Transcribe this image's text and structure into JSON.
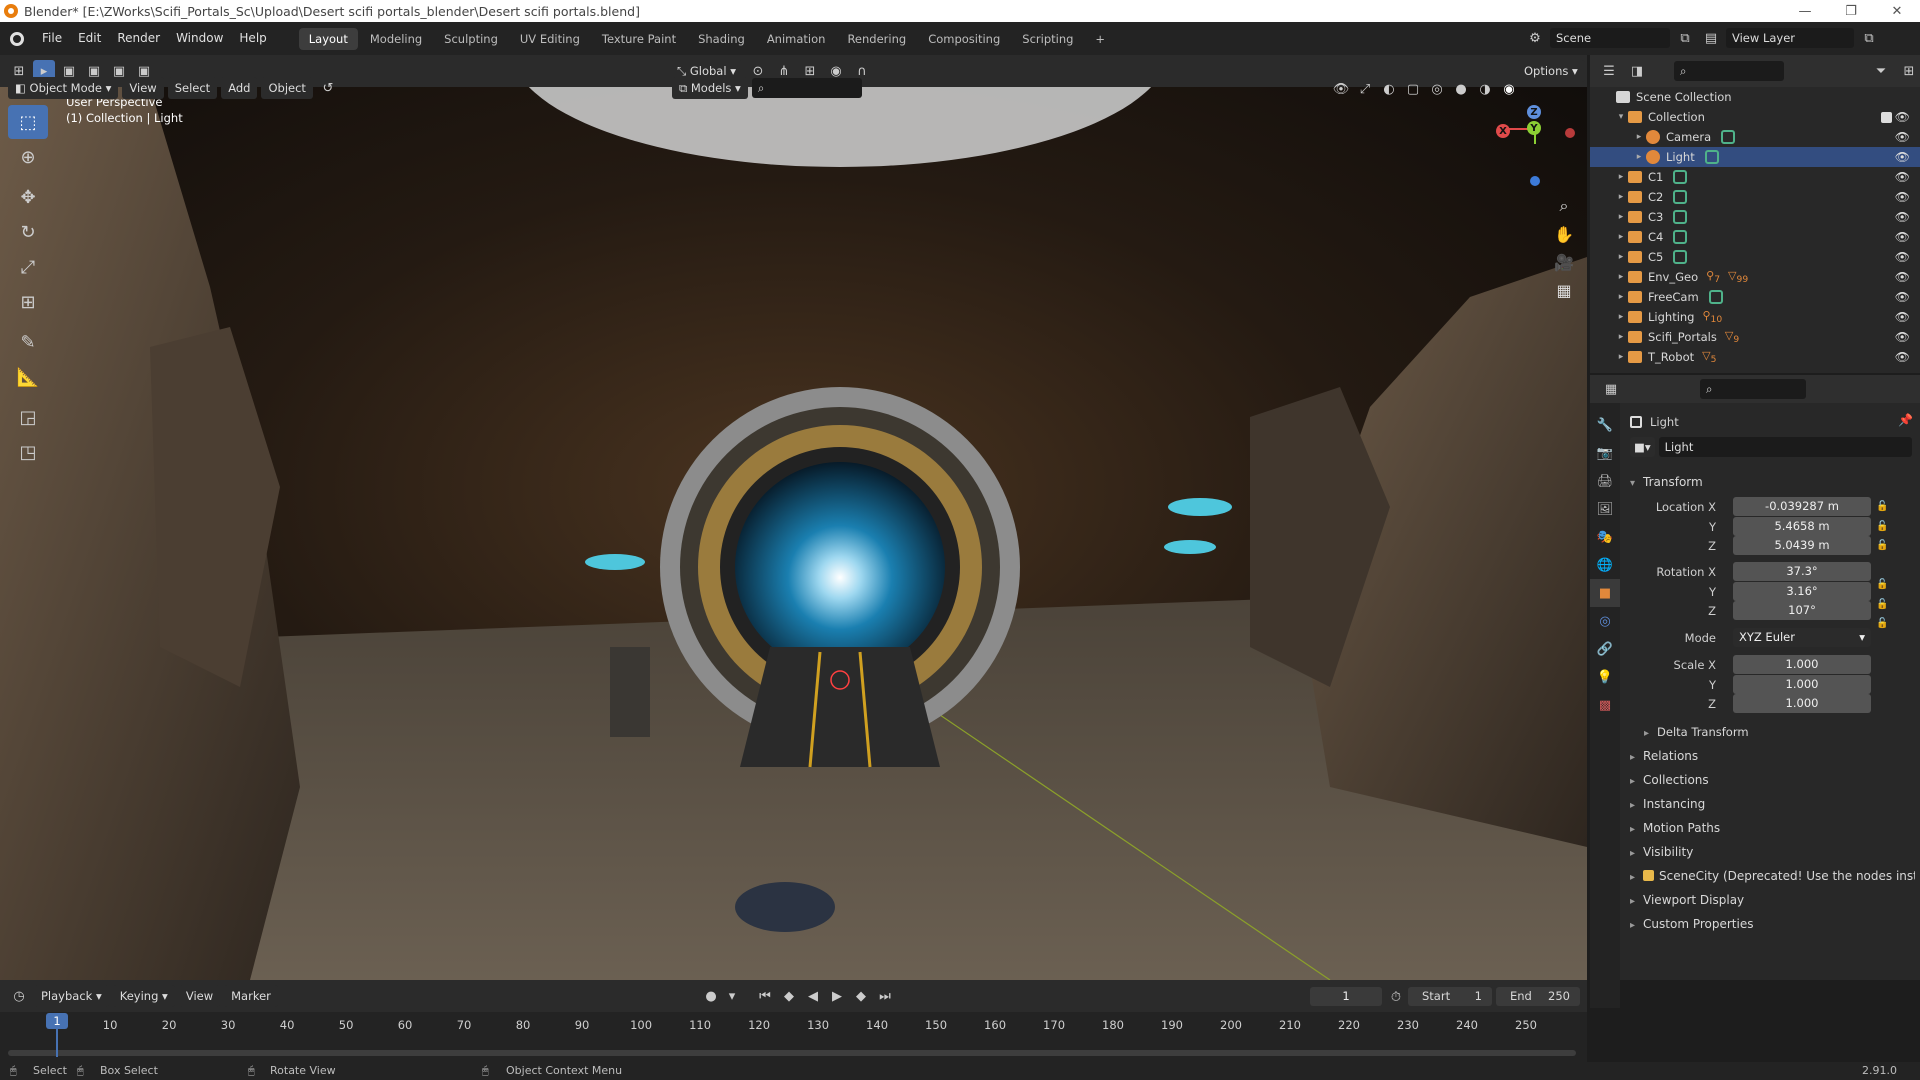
{
  "window": {
    "title": "Blender* [E:\\ZWorks\\Scifi_Portals_Sc\\Upload\\Desert scifi portals_blender\\Desert scifi portals.blend]",
    "controls": [
      "—",
      "❐",
      "✕"
    ]
  },
  "menu": [
    "File",
    "Edit",
    "Render",
    "Window",
    "Help"
  ],
  "workspaces": {
    "tabs": [
      "Layout",
      "Modeling",
      "Sculpting",
      "UV Editing",
      "Texture Paint",
      "Shading",
      "Animation",
      "Rendering",
      "Compositing",
      "Scripting"
    ],
    "active": "Layout",
    "add": "+"
  },
  "scene": {
    "label": "Scene",
    "view_layer": "View Layer"
  },
  "viewport_header": {
    "mode": "Object Mode",
    "menus": [
      "View",
      "Select",
      "Add",
      "Object"
    ],
    "transform_orientation": "Global",
    "collection_filter": "Models",
    "options": "Options"
  },
  "viewport": {
    "perspective": "User Perspective",
    "context": "(1) Collection | Light",
    "gizmo": {
      "x": "X",
      "y": "Y",
      "z": "Z"
    }
  },
  "outliner": {
    "root": "Scene Collection",
    "rows": [
      {
        "name": "Collection",
        "level": 1,
        "expanded": true,
        "type": "collection"
      },
      {
        "name": "Camera",
        "level": 2,
        "type": "object"
      },
      {
        "name": "Light",
        "level": 2,
        "type": "object",
        "selected": true
      },
      {
        "name": "C1",
        "level": 1,
        "type": "collection"
      },
      {
        "name": "C2",
        "level": 1,
        "type": "collection"
      },
      {
        "name": "C3",
        "level": 1,
        "type": "collection"
      },
      {
        "name": "C4",
        "level": 1,
        "type": "collection"
      },
      {
        "name": "C5",
        "level": 1,
        "type": "collection"
      },
      {
        "name": "Env_Geo",
        "level": 1,
        "type": "collection",
        "badge1": "7",
        "badge2": "99"
      },
      {
        "name": "FreeCam",
        "level": 1,
        "type": "collection"
      },
      {
        "name": "Lighting",
        "level": 1,
        "type": "collection",
        "badge1": "10"
      },
      {
        "name": "Scifi_Portals",
        "level": 1,
        "type": "collection",
        "badge2": "9"
      },
      {
        "name": "T_Robot",
        "level": 1,
        "type": "collection",
        "badge2": "5"
      }
    ]
  },
  "properties": {
    "object_name": "Light",
    "datablock": "Light",
    "transform": {
      "title": "Transform",
      "location_label": "Location X",
      "location": [
        "-0.039287 m",
        "5.4658 m",
        "5.0439 m"
      ],
      "rotation_label": "Rotation X",
      "rotation": [
        "37.3°",
        "3.16°",
        "107°"
      ],
      "mode_label": "Mode",
      "mode": "XYZ Euler",
      "scale_label": "Scale X",
      "scale": [
        "1.000",
        "1.000",
        "1.000"
      ],
      "y": "Y",
      "z": "Z",
      "delta": "Delta Transform"
    },
    "panels": [
      "Relations",
      "Collections",
      "Instancing",
      "Motion Paths",
      "Visibility",
      "SceneCity (Deprecated! Use the nodes instead",
      "Viewport Display",
      "Custom Properties"
    ]
  },
  "timeline": {
    "menus": [
      "Playback",
      "Keying",
      "View",
      "Marker"
    ],
    "current_frame": "1",
    "start_label": "Start",
    "start": "1",
    "end_label": "End",
    "end": "250",
    "ticks": [
      "10",
      "20",
      "30",
      "40",
      "50",
      "60",
      "70",
      "80",
      "90",
      "100",
      "110",
      "120",
      "130",
      "140",
      "150",
      "160",
      "170",
      "180",
      "190",
      "200",
      "210",
      "220",
      "230",
      "240",
      "250"
    ]
  },
  "statusbar": {
    "select": "Select",
    "box_select": "Box Select",
    "rotate": "Rotate View",
    "context_menu": "Object Context Menu",
    "version": "2.91.0"
  }
}
